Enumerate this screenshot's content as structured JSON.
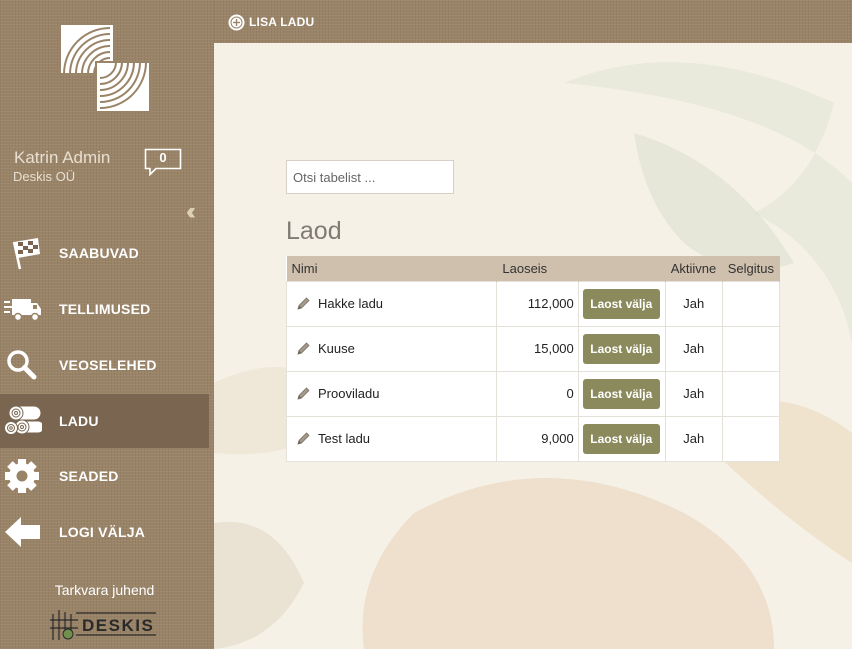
{
  "user": {
    "name": "Katrin Admin",
    "company": "Deskis OÜ",
    "message_count": "0"
  },
  "collapse_icon": "double-chevron-left-icon",
  "nav": [
    {
      "label": "SAABUVAD",
      "icon": "checkered-flag-icon",
      "active": false
    },
    {
      "label": "TELLIMUSED",
      "icon": "truck-icon",
      "active": false
    },
    {
      "label": "VEOSELEHED",
      "icon": "magnifier-icon",
      "active": false
    },
    {
      "label": "LADU",
      "icon": "logs-icon",
      "active": true
    },
    {
      "label": "SEADED",
      "icon": "gear-icon",
      "active": false
    },
    {
      "label": "LOGI VÄLJA",
      "icon": "arrow-left-icon",
      "active": false
    }
  ],
  "footer": {
    "guide": "Tarkvara juhend",
    "brand": "DESKIS"
  },
  "toolbar": {
    "add_label": "LISA LADU"
  },
  "search": {
    "placeholder": "Otsi tabelist ..."
  },
  "page": {
    "title": "Laod"
  },
  "table": {
    "columns": [
      "Nimi",
      "Laoseis",
      "",
      "Aktiivne",
      "Selgitus"
    ],
    "rows": [
      {
        "name": "Hakke ladu",
        "stock": "112,000",
        "action": "Laost välja",
        "active": "Jah",
        "note": ""
      },
      {
        "name": "Kuuse",
        "stock": "15,000",
        "action": "Laost välja",
        "active": "Jah",
        "note": ""
      },
      {
        "name": "Prooviladu",
        "stock": "0",
        "action": "Laost välja",
        "active": "Jah",
        "note": ""
      },
      {
        "name": "Test ladu",
        "stock": "9,000",
        "action": "Laost välja",
        "active": "Jah",
        "note": ""
      }
    ]
  },
  "colors": {
    "sidebar": "#9a8468",
    "active_nav": "#7a6650",
    "header_row": "#cfc0ad",
    "button": "#8a8a5c"
  }
}
